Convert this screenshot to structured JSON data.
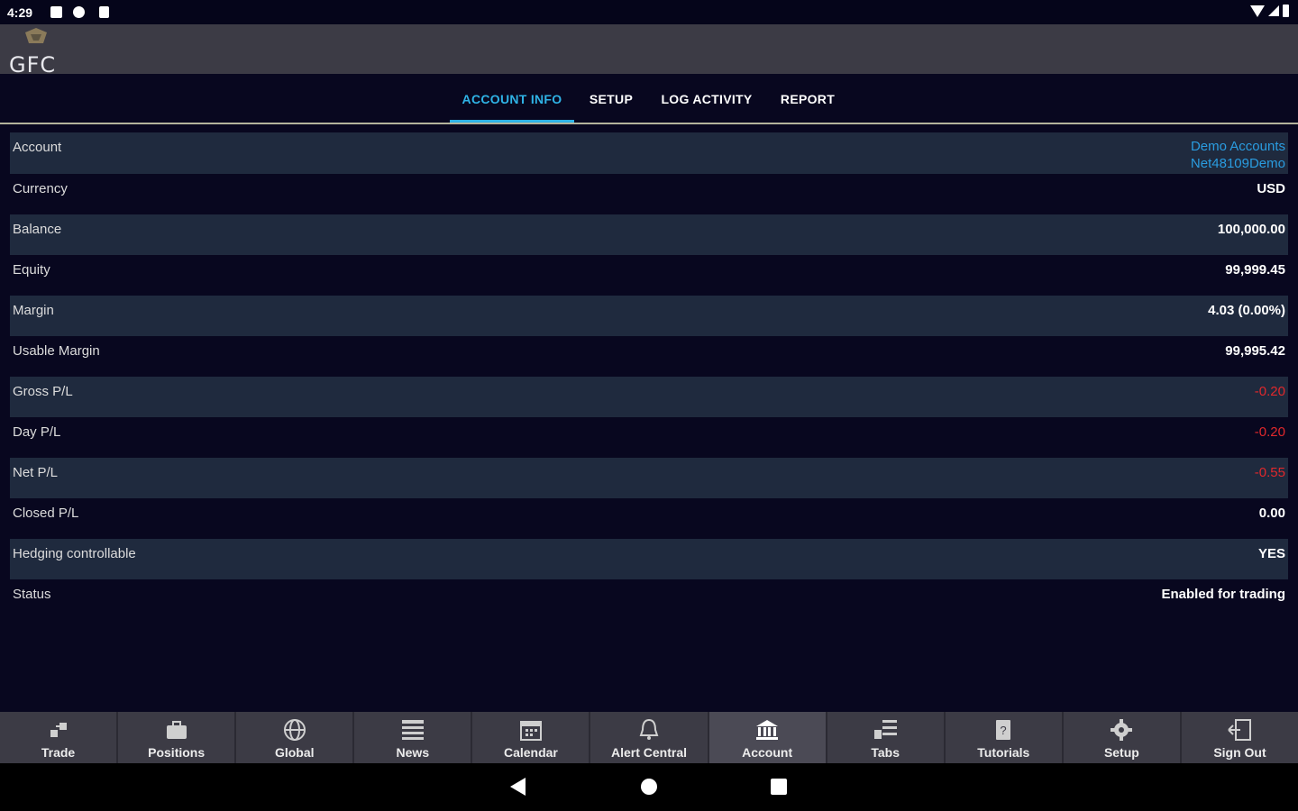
{
  "status_bar": {
    "time": "4:29",
    "icons": [
      "notification-icon",
      "notification-icon",
      "notification-icon"
    ],
    "right_icons": [
      "wifi-icon",
      "cell-signal-icon",
      "battery-icon"
    ]
  },
  "app": {
    "logo_text": "GFC"
  },
  "tabs": [
    {
      "label": "Account Info",
      "active": true
    },
    {
      "label": "Setup",
      "active": false
    },
    {
      "label": "Log Activity",
      "active": false
    },
    {
      "label": "Report",
      "active": false
    }
  ],
  "account_rows": [
    {
      "label": "Account",
      "value_line1": "Demo Accounts",
      "value_line2": "Net48109Demo"
    },
    {
      "label": "Currency",
      "value": "USD"
    },
    {
      "label": "Balance",
      "value": "100,000.00"
    },
    {
      "label": "Equity",
      "value": "99,999.45"
    },
    {
      "label": "Margin",
      "value": "4.03 (0.00%)"
    },
    {
      "label": "Usable Margin",
      "value": "99,995.42"
    },
    {
      "label": "Gross P/L",
      "value": "-0.20"
    },
    {
      "label": "Day P/L",
      "value": "-0.20"
    },
    {
      "label": "Net P/L",
      "value": "-0.55"
    },
    {
      "label": "Closed P/L",
      "value": "0.00"
    },
    {
      "label": "Hedging controllable",
      "value": "YES"
    },
    {
      "label": "Status",
      "value": "Enabled for trading"
    }
  ],
  "bottom_nav": [
    {
      "label": "Trade",
      "icon": "trade-icon"
    },
    {
      "label": "Positions",
      "icon": "briefcase-icon"
    },
    {
      "label": "Global",
      "icon": "globe-icon"
    },
    {
      "label": "News",
      "icon": "news-icon"
    },
    {
      "label": "Calendar",
      "icon": "calendar-icon"
    },
    {
      "label": "Alert Central",
      "icon": "bell-icon"
    },
    {
      "label": "Account",
      "icon": "bank-icon",
      "active": true
    },
    {
      "label": "Tabs",
      "icon": "tabs-icon"
    },
    {
      "label": "Tutorials",
      "icon": "tutorial-icon"
    },
    {
      "label": "Setup",
      "icon": "gear-icon"
    },
    {
      "label": "Sign Out",
      "icon": "sign-out-icon"
    }
  ],
  "colors": {
    "background": "#08071f",
    "header": "#3c3b45",
    "row_alt": "#1f2a3e",
    "accent": "#2fb3e6",
    "negative": "#e0282c"
  }
}
